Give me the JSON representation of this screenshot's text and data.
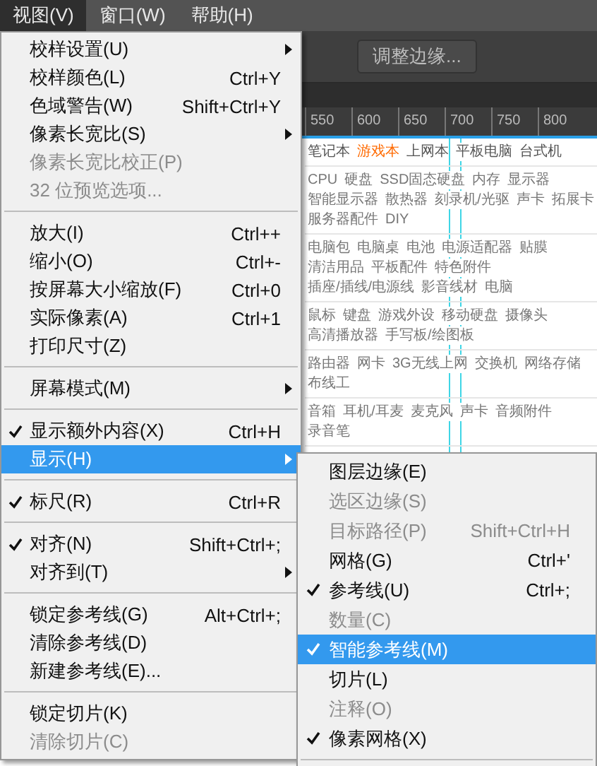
{
  "menubar": [
    {
      "label": "视图(V)",
      "selected": true
    },
    {
      "label": "窗口(W)",
      "selected": false
    },
    {
      "label": "帮助(H)",
      "selected": false
    }
  ],
  "toolbar": {
    "button": "调整边缘..."
  },
  "ruler": {
    "ticks": [
      "550",
      "600",
      "650",
      "700",
      "750",
      "800"
    ]
  },
  "page": {
    "tabs": [
      {
        "label": "笔记本",
        "selected": false
      },
      {
        "label": "游戏本",
        "selected": true
      },
      {
        "label": "上网本",
        "selected": false
      },
      {
        "label": "平板电脑",
        "selected": false
      },
      {
        "label": "台式机",
        "selected": false
      }
    ],
    "groups": [
      {
        "links": [
          "CPU",
          "硬盘",
          "SSD固态硬盘",
          "内存",
          "显示器",
          "智能显示器",
          "散热器",
          "刻录机/光驱",
          "声卡",
          "拓展卡",
          "服务器配件",
          "DIY"
        ]
      },
      {
        "links": [
          "电脑包",
          "电脑桌",
          "电池",
          "电源适配器",
          "贴膜",
          "清洁用品",
          "平板配件",
          "特色附件",
          "插座/插线/电源线",
          "影音线材",
          "电脑"
        ]
      },
      {
        "links": [
          "鼠标",
          "键盘",
          "游戏外设",
          "移动硬盘",
          "摄像头",
          "高清播放器",
          "手写板/绘图板"
        ]
      },
      {
        "links": [
          "路由器",
          "网卡",
          "3G无线上网",
          "交换机",
          "网络存储",
          "布线工"
        ]
      },
      {
        "links": [
          "音箱",
          "耳机/耳麦",
          "麦克风",
          "声卡",
          "音频附件",
          "录音笔"
        ]
      }
    ]
  },
  "menu": [
    {
      "kind": "item",
      "label": "校样设置(U)",
      "submenu": true,
      "checked": false,
      "disabled": false,
      "selected": false
    },
    {
      "kind": "item",
      "label": "校样颜色(L)",
      "shortcut": "Ctrl+Y",
      "checked": false,
      "disabled": false,
      "selected": false
    },
    {
      "kind": "item",
      "label": "色域警告(W)",
      "shortcut": "Shift+Ctrl+Y",
      "checked": false,
      "disabled": false,
      "selected": false
    },
    {
      "kind": "item",
      "label": "像素长宽比(S)",
      "submenu": true,
      "checked": false,
      "disabled": false,
      "selected": false
    },
    {
      "kind": "item",
      "label": "像素长宽比校正(P)",
      "checked": false,
      "disabled": true,
      "selected": false
    },
    {
      "kind": "item",
      "label": "32 位预览选项...",
      "checked": false,
      "disabled": true,
      "selected": false
    },
    {
      "kind": "separator"
    },
    {
      "kind": "item",
      "label": "放大(I)",
      "shortcut": "Ctrl++",
      "checked": false,
      "disabled": false,
      "selected": false
    },
    {
      "kind": "item",
      "label": "缩小(O)",
      "shortcut": "Ctrl+-",
      "checked": false,
      "disabled": false,
      "selected": false
    },
    {
      "kind": "item",
      "label": "按屏幕大小缩放(F)",
      "shortcut": "Ctrl+0",
      "checked": false,
      "disabled": false,
      "selected": false
    },
    {
      "kind": "item",
      "label": "实际像素(A)",
      "shortcut": "Ctrl+1",
      "checked": false,
      "disabled": false,
      "selected": false
    },
    {
      "kind": "item",
      "label": "打印尺寸(Z)",
      "checked": false,
      "disabled": false,
      "selected": false
    },
    {
      "kind": "separator"
    },
    {
      "kind": "item",
      "label": "屏幕模式(M)",
      "submenu": true,
      "checked": false,
      "disabled": false,
      "selected": false
    },
    {
      "kind": "separator"
    },
    {
      "kind": "item",
      "label": "显示额外内容(X)",
      "shortcut": "Ctrl+H",
      "checked": true,
      "disabled": false,
      "selected": false
    },
    {
      "kind": "item",
      "label": "显示(H)",
      "submenu": true,
      "checked": false,
      "disabled": false,
      "selected": true
    },
    {
      "kind": "separator"
    },
    {
      "kind": "item",
      "label": "标尺(R)",
      "shortcut": "Ctrl+R",
      "checked": true,
      "disabled": false,
      "selected": false
    },
    {
      "kind": "separator"
    },
    {
      "kind": "item",
      "label": "对齐(N)",
      "shortcut": "Shift+Ctrl+;",
      "checked": true,
      "disabled": false,
      "selected": false
    },
    {
      "kind": "item",
      "label": "对齐到(T)",
      "submenu": true,
      "checked": false,
      "disabled": false,
      "selected": false
    },
    {
      "kind": "separator"
    },
    {
      "kind": "item",
      "label": "锁定参考线(G)",
      "shortcut": "Alt+Ctrl+;",
      "checked": false,
      "disabled": false,
      "selected": false
    },
    {
      "kind": "item",
      "label": "清除参考线(D)",
      "checked": false,
      "disabled": false,
      "selected": false
    },
    {
      "kind": "item",
      "label": "新建参考线(E)...",
      "checked": false,
      "disabled": false,
      "selected": false
    },
    {
      "kind": "separator"
    },
    {
      "kind": "item",
      "label": "锁定切片(K)",
      "checked": false,
      "disabled": false,
      "selected": false
    },
    {
      "kind": "item",
      "label": "清除切片(C)",
      "checked": false,
      "disabled": true,
      "selected": false
    }
  ],
  "submenu": [
    {
      "kind": "item",
      "label": "图层边缘(E)",
      "checked": false,
      "disabled": false,
      "selected": false
    },
    {
      "kind": "item",
      "label": "选区边缘(S)",
      "checked": false,
      "disabled": true,
      "selected": false
    },
    {
      "kind": "item",
      "label": "目标路径(P)",
      "shortcut": "Shift+Ctrl+H",
      "checked": false,
      "disabled": true,
      "selected": false
    },
    {
      "kind": "item",
      "label": "网格(G)",
      "shortcut": "Ctrl+'",
      "checked": false,
      "disabled": false,
      "selected": false
    },
    {
      "kind": "item",
      "label": "参考线(U)",
      "shortcut": "Ctrl+;",
      "checked": true,
      "disabled": false,
      "selected": false
    },
    {
      "kind": "item",
      "label": "数量(C)",
      "checked": false,
      "disabled": true,
      "selected": false
    },
    {
      "kind": "item",
      "label": "智能参考线(M)",
      "checked": true,
      "disabled": false,
      "selected": true
    },
    {
      "kind": "item",
      "label": "切片(L)",
      "checked": false,
      "disabled": false,
      "selected": false
    },
    {
      "kind": "item",
      "label": "注释(O)",
      "checked": false,
      "disabled": true,
      "selected": false
    },
    {
      "kind": "item",
      "label": "像素网格(X)",
      "checked": true,
      "disabled": false,
      "selected": false
    },
    {
      "kind": "separator"
    }
  ]
}
